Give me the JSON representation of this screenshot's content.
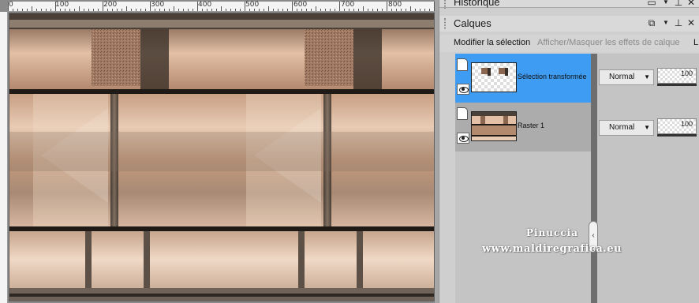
{
  "ruler": {
    "labels": [
      "0",
      "100",
      "200",
      "300",
      "400",
      "500",
      "600",
      "700",
      "800"
    ]
  },
  "panels": {
    "historique": {
      "title": "Historique"
    },
    "calques": {
      "title": "Calques",
      "toolbar": {
        "modify_selection": "Modifier la sélection",
        "toggle_effects": "Afficher/Masquer les effets de calque",
        "truncated": "L"
      },
      "layers": [
        {
          "name": "Sélection transformée",
          "blend": "Normal",
          "opacity": "100",
          "selected": true
        },
        {
          "name": "Raster 1",
          "blend": "Normal",
          "opacity": "100",
          "selected": false
        }
      ]
    }
  },
  "watermark": {
    "line1": "Pinuccia",
    "line2": "www.maldiregrafica.eu"
  },
  "colors": {
    "selection": "#3e9cf3",
    "image_peach": "#d9b49b",
    "image_dark": "#4a3e33"
  },
  "icons": {
    "pane_menu": "window-menu-icon",
    "dropdown": "chevron-down-icon",
    "pin": "pin-icon",
    "close": "close-icon",
    "visibility": "eye-icon"
  }
}
